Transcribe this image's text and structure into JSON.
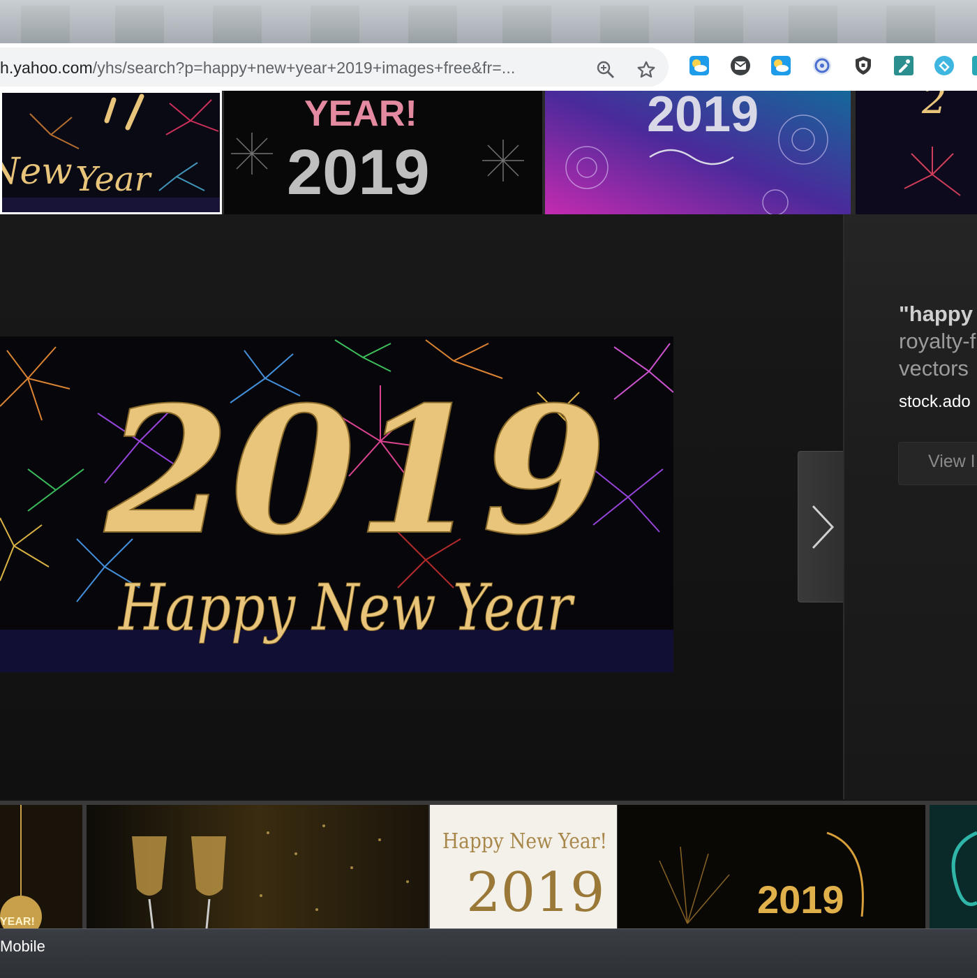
{
  "browser": {
    "url_host": "h.yahoo.com",
    "url_path": "/yhs/search?p=happy+new+year+2019+images+free&fr=...",
    "icons": {
      "zoom": "zoom-in-icon",
      "bookmark": "star-icon"
    },
    "extensions": [
      "weather-extension-icon",
      "mail-extension-icon",
      "weather-extension-icon",
      "speedtest-extension-icon",
      "shield-extension-icon",
      "eyedropper-extension-icon",
      "tab-extension-icon",
      "more-extension-icon"
    ]
  },
  "top_thumbnails": [
    {
      "text_a": "New",
      "text_b": "Year"
    },
    {
      "text_a": "YEAR!",
      "text_b": "2019"
    },
    {
      "text_a": "2019",
      "text_b": ""
    },
    {
      "text_a": "2",
      "text_b": ""
    }
  ],
  "viewer": {
    "image_year": "2019",
    "image_caption": "Happy New Year",
    "next_icon": "chevron-right-icon"
  },
  "result_panel": {
    "title_query": "\"happy",
    "title_line2": "royalty-f",
    "title_line3": "vectors",
    "source": "stock.ado",
    "view_button": "View I"
  },
  "bottom_thumbnails": [
    {
      "text": "YEAR!"
    },
    {
      "text": ""
    },
    {
      "text_a": "Happy New Year!",
      "text_b": "2019"
    },
    {
      "text": "2019"
    },
    {
      "text": ""
    }
  ],
  "taskbar": {
    "label": "Mobile"
  },
  "colors": {
    "gold": "#e8c57a",
    "viewer_bg": "#141414",
    "toolbar_bg": "#ffffff"
  }
}
